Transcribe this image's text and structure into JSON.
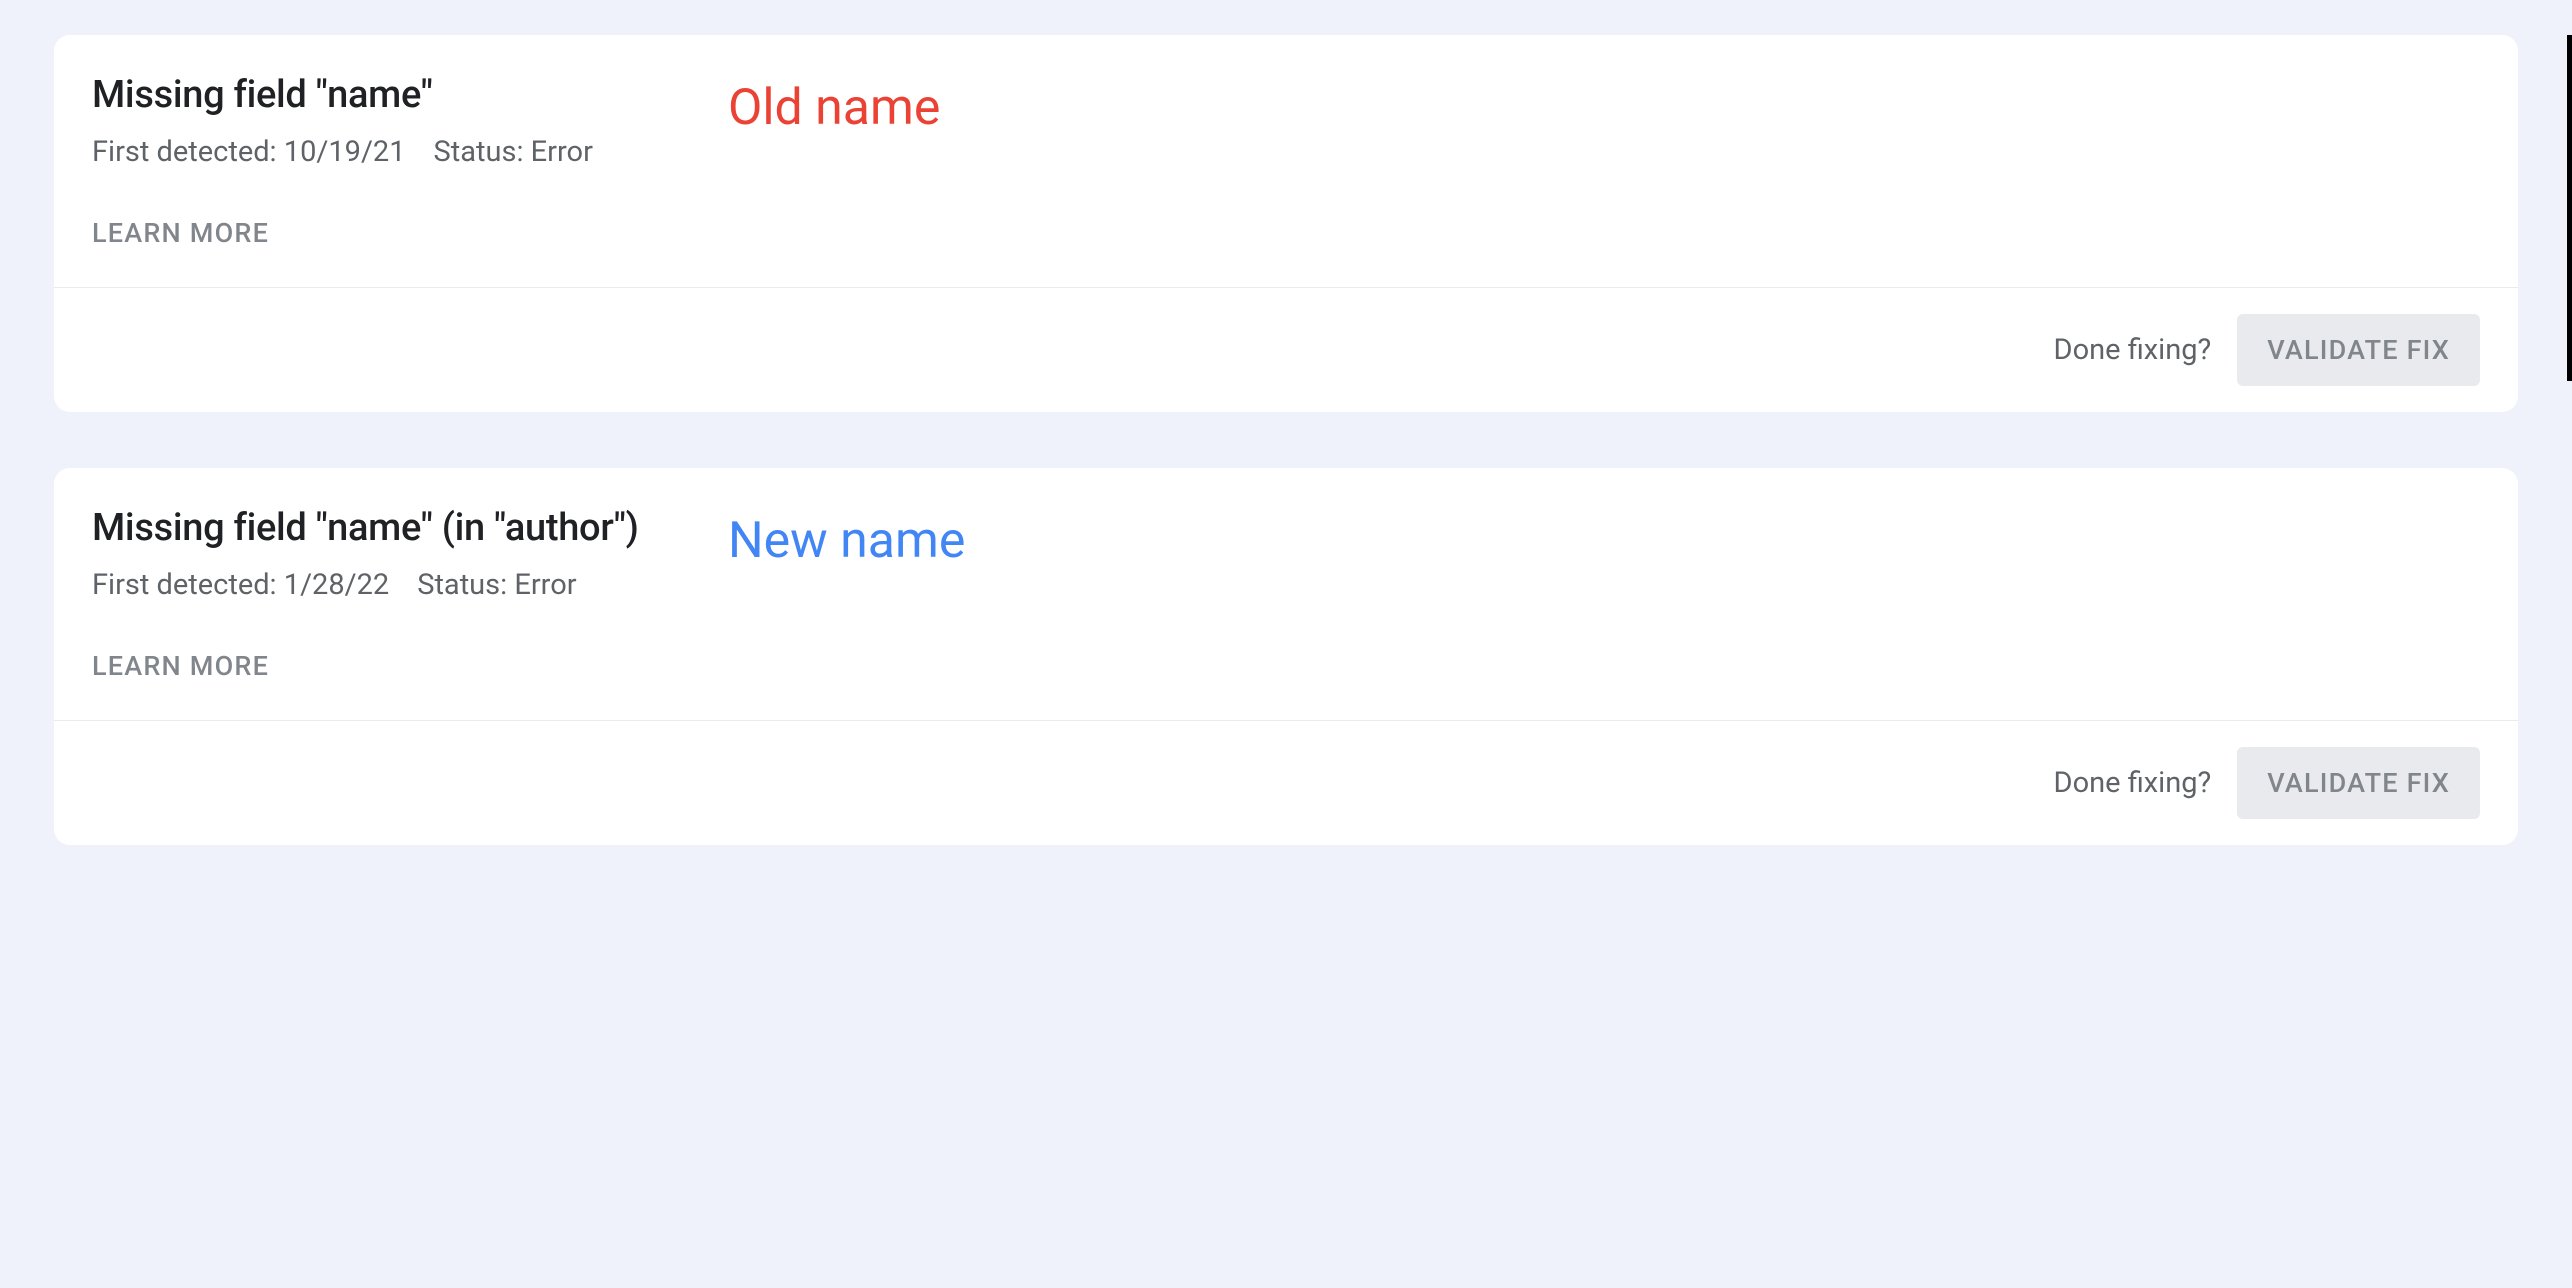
{
  "issues": [
    {
      "title": "Missing field \"name\"",
      "annotation": "Old name",
      "annotation_class": "annotation-old",
      "first_detected_label": "First detected:",
      "first_detected_date": "10/19/21",
      "status_label": "Status:",
      "status_value": "Error",
      "learn_more_label": "LEARN MORE",
      "done_fixing_label": "Done fixing?",
      "validate_fix_label": "VALIDATE FIX"
    },
    {
      "title": "Missing field \"name\" (in \"author\")",
      "annotation": "New name",
      "annotation_class": "annotation-new",
      "first_detected_label": "First detected:",
      "first_detected_date": "1/28/22",
      "status_label": "Status:",
      "status_value": "Error",
      "learn_more_label": "LEARN MORE",
      "done_fixing_label": "Done fixing?",
      "validate_fix_label": "VALIDATE FIX"
    }
  ]
}
